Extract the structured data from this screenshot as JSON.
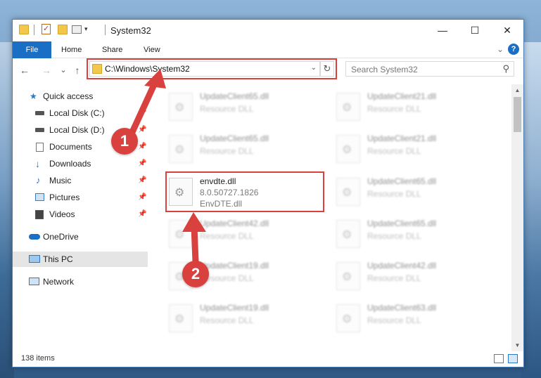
{
  "window": {
    "title": "System32",
    "controls": {
      "minimize": "—",
      "maximize": "☐",
      "close": "✕"
    }
  },
  "ribbon": {
    "tabs": [
      "File",
      "Home",
      "Share",
      "View"
    ],
    "help": "?"
  },
  "nav": {
    "back": "←",
    "forward": "→",
    "recent": "⌄",
    "up": "↑",
    "address": "C:\\Windows\\System32",
    "refresh": "↻",
    "search_placeholder": "Search System32",
    "search_icon_glyph": "⚲"
  },
  "sidebar": {
    "items": [
      {
        "label": "Quick access",
        "icon": "star-icon"
      },
      {
        "label": "Local Disk (C:)",
        "icon": "drive-icon",
        "pinned": true
      },
      {
        "label": "Local Disk (D:)",
        "icon": "drive-icon",
        "pinned": true
      },
      {
        "label": "Documents",
        "icon": "documents-icon",
        "pinned": true
      },
      {
        "label": "Downloads",
        "icon": "download-icon",
        "pinned": true
      },
      {
        "label": "Music",
        "icon": "music-icon",
        "pinned": true
      },
      {
        "label": "Pictures",
        "icon": "pictures-icon",
        "pinned": true
      },
      {
        "label": "Videos",
        "icon": "videos-icon",
        "pinned": true
      },
      {
        "label": "OneDrive",
        "icon": "cloud-icon"
      },
      {
        "label": "This PC",
        "icon": "computer-icon",
        "selected": true
      },
      {
        "label": "Network",
        "icon": "network-icon"
      }
    ],
    "pin_glyph": "📌"
  },
  "files": {
    "left": [
      {
        "name": "UpdateClient65.dll",
        "type": "Resource DLL"
      },
      {
        "name": "UpdateClient65.dll",
        "type": "Resource DLL"
      },
      {
        "name": "envdte.dll",
        "version": "8.0.50727.1826",
        "desc": "EnvDTE.dll"
      },
      {
        "name": "UpdateClient42.dll",
        "type": "Resource DLL"
      },
      {
        "name": "UpdateClient19.dll",
        "type": "Resource DLL"
      },
      {
        "name": "UpdateClient19.dll",
        "type": "Resource DLL"
      }
    ],
    "right": [
      {
        "name": "UpdateClient21.dll",
        "type": "Resource DLL"
      },
      {
        "name": "UpdateClient21.dll",
        "type": "Resource DLL"
      },
      {
        "name": "UpdateClient65.dll",
        "type": "Resource DLL"
      },
      {
        "name": "UpdateClient65.dll",
        "type": "Resource DLL"
      },
      {
        "name": "UpdateClient42.dll",
        "type": "Resource DLL"
      },
      {
        "name": "UpdateClient63.dll",
        "type": "Resource DLL"
      }
    ]
  },
  "status": {
    "item_count": "138 items"
  },
  "annotations": {
    "callout1": "1",
    "callout2": "2",
    "color": "#d9413e"
  }
}
